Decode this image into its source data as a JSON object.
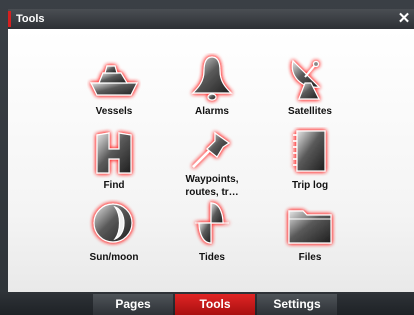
{
  "window": {
    "title": "Tools",
    "close_glyph": "✕"
  },
  "tools": [
    {
      "label": "Vessels",
      "icon": "boat-icon"
    },
    {
      "label": "Alarms",
      "icon": "bell-icon"
    },
    {
      "label": "Satellites",
      "icon": "satellite-dish-icon"
    },
    {
      "label": "Find",
      "icon": "find-icon"
    },
    {
      "label": "Waypoints,",
      "label2": "routes, tr…",
      "icon": "pushpin-icon"
    },
    {
      "label": "Trip log",
      "icon": "notebook-icon"
    },
    {
      "label": "Sun/moon",
      "icon": "sun-moon-icon"
    },
    {
      "label": "Tides",
      "icon": "wave-icon"
    },
    {
      "label": "Files",
      "icon": "folder-icon"
    }
  ],
  "tabs": [
    {
      "label": "Pages",
      "active": false
    },
    {
      "label": "Tools",
      "active": true
    },
    {
      "label": "Settings",
      "active": false
    }
  ],
  "colors": {
    "accent": "#d42020",
    "icon_glow": "#ff2a2a",
    "icon_fill": "#3c3c3c"
  }
}
